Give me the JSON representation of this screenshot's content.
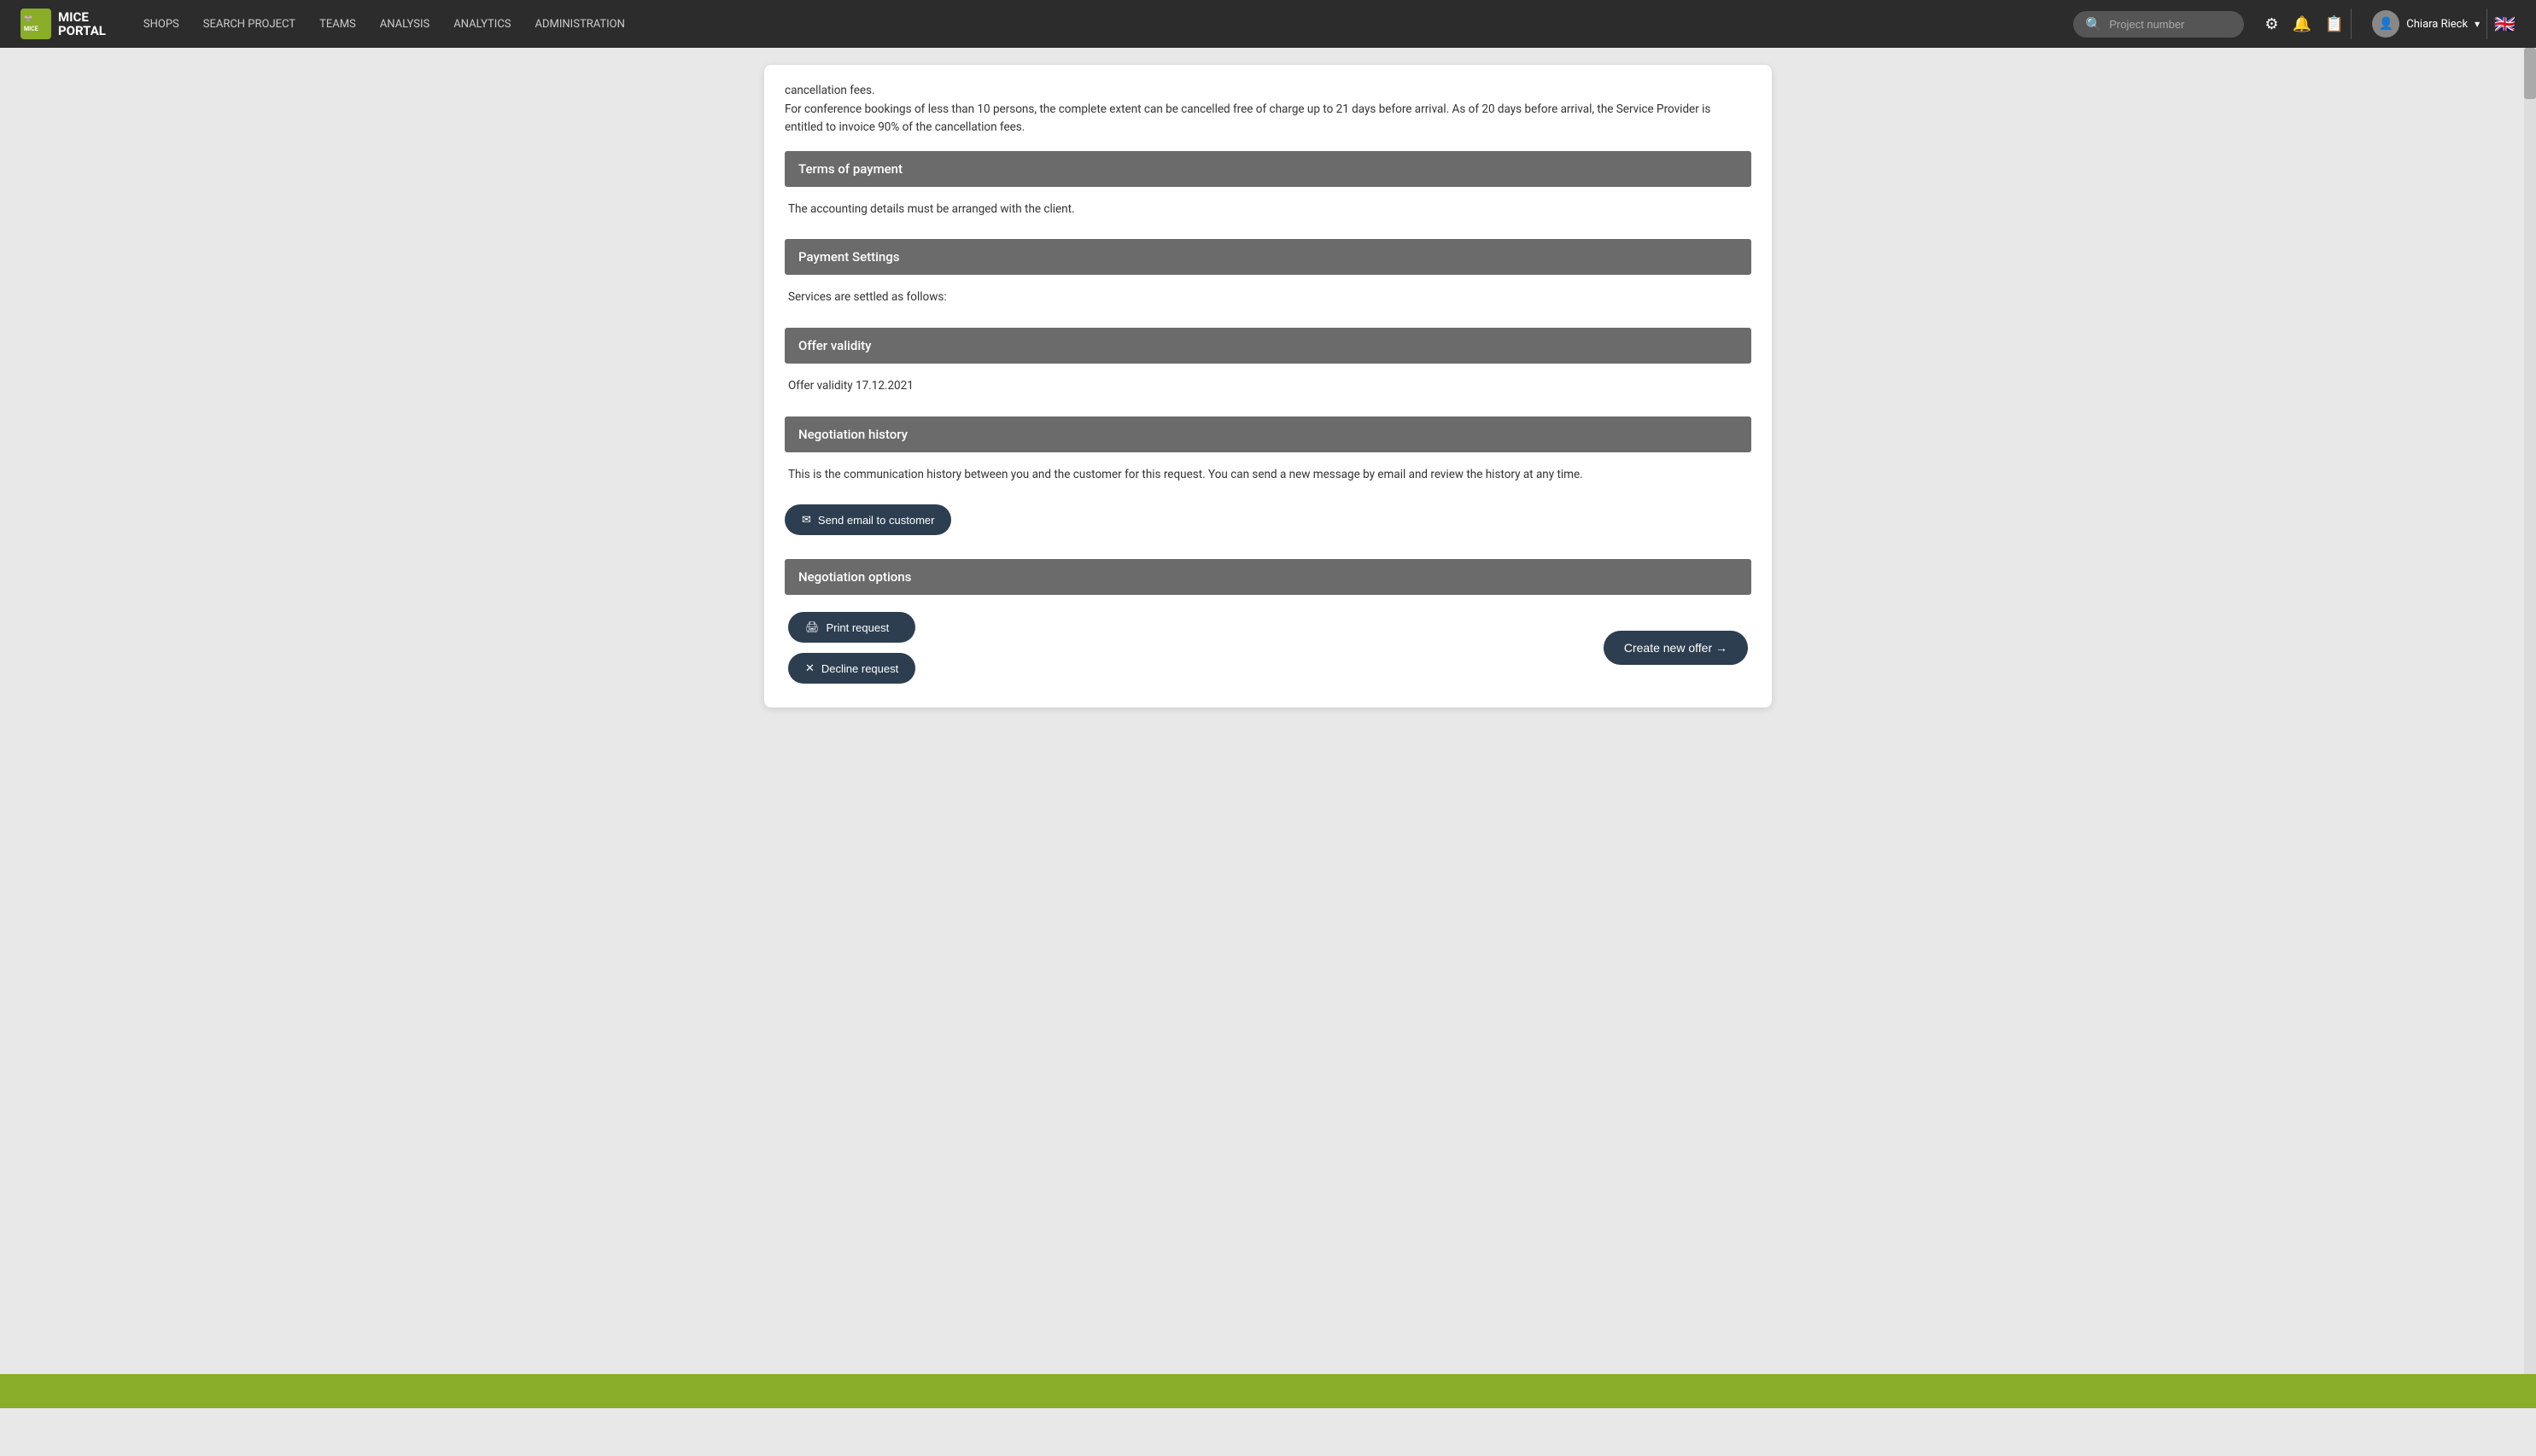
{
  "navbar": {
    "logo_line1": "MICE",
    "logo_line2": "PORTAL",
    "links": [
      "SHOPS",
      "SEARCH PROJECT",
      "TEAMS",
      "ANALYSIS",
      "ANALYTICS",
      "ADMINISTRATION"
    ],
    "search_placeholder": "Project number",
    "user_name": "Chiara Rieck",
    "chevron": "▾",
    "flag": "🇬🇧"
  },
  "page": {
    "intro_text": "cancellation fees.\nFor conference bookings of less than 10 persons, the complete extent can be cancelled free of charge up to 21 days before arrival. As of 20 days before arrival, the Service Provider is entitled to invoice 90% of the cancellation fees.",
    "sections": [
      {
        "id": "terms-of-payment",
        "header": "Terms of payment",
        "body": "The accounting details must be arranged with the client."
      },
      {
        "id": "payment-settings",
        "header": "Payment Settings",
        "body": "Services are settled as follows:"
      },
      {
        "id": "offer-validity",
        "header": "Offer validity",
        "body": "Offer validity 17.12.2021"
      },
      {
        "id": "negotiation-history",
        "header": "Negotiation history",
        "body": "This is the communication history between you and the customer for this request. You can send a new message by email and review the history at any time."
      }
    ],
    "send_email_button": "Send email to customer",
    "negotiation_options_header": "Negotiation options",
    "print_request_button": "Print request",
    "decline_request_button": "Decline request",
    "create_offer_button": "Create new offer →"
  },
  "icons": {
    "search": "🔍",
    "gear": "⚙",
    "bell": "🔔",
    "document": "📋",
    "user": "👤",
    "email": "✉",
    "printer": "🖨",
    "close": "✕",
    "arrow_right": "→"
  }
}
